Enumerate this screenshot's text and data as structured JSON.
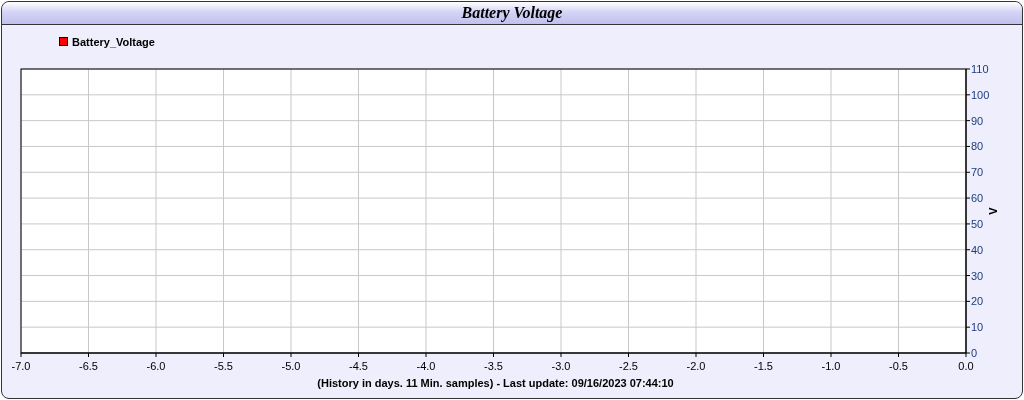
{
  "window": {
    "title": "Battery Voltage"
  },
  "chart": {
    "chart_data": {
      "type": "line",
      "xlabel": "(History in days. 11 Min. samples) - Last update: 09/16/2023 07:44:10",
      "ylabel": "V",
      "series": [
        {
          "name": "Battery_Voltage",
          "color": "#ff0000",
          "values": [
            null,
            null,
            null,
            null,
            null,
            null,
            null,
            null,
            null,
            null,
            null,
            null,
            null,
            null,
            null
          ]
        }
      ],
      "categories": [
        "-7.0",
        "-6.5",
        "-6.0",
        "-5.5",
        "-5.0",
        "-4.5",
        "-4.0",
        "-3.5",
        "-3.0",
        "-2.5",
        "-2.0",
        "-1.5",
        "-1.0",
        "-0.5",
        "0.0"
      ],
      "ylim": [
        0,
        110
      ],
      "yticks": [
        0,
        10,
        20,
        30,
        40,
        50,
        60,
        70,
        80,
        90,
        100,
        110
      ],
      "grid": true
    }
  }
}
